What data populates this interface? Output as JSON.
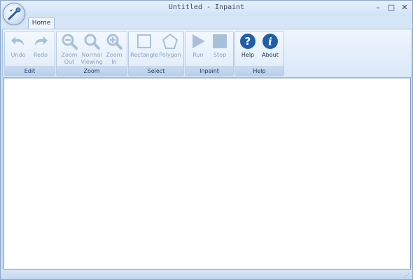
{
  "window": {
    "title": "Untitled - Inpaint"
  },
  "window_controls": {
    "minimize": "–",
    "maximize": "□",
    "close": "✕"
  },
  "tabs": [
    {
      "label": "Home"
    }
  ],
  "groups": {
    "edit": {
      "label": "Edit",
      "buttons": {
        "undo": "Undo",
        "redo": "Redo"
      }
    },
    "zoom": {
      "label": "Zoom",
      "buttons": {
        "zoom_out_1": "Zoom",
        "zoom_out_2": "Out",
        "normal_1": "Normal",
        "normal_2": "Viewing",
        "zoom_in_1": "Zoom",
        "zoom_in_2": "In"
      }
    },
    "select": {
      "label": "Select",
      "buttons": {
        "rectangle": "Rectangle",
        "polygon": "Polygon"
      }
    },
    "inpaint": {
      "label": "Inpaint",
      "buttons": {
        "run": "Run",
        "stop": "Stop"
      }
    },
    "help": {
      "label": "Help",
      "buttons": {
        "help": "Help",
        "about": "About"
      }
    }
  },
  "colors": {
    "disabled_icon": "#a9c0da",
    "help_icon": "#1f5fa8",
    "window_frame": "#c9ddf2"
  },
  "icons": [
    "app-orb-icon",
    "undo-icon",
    "redo-icon",
    "zoom-out-icon",
    "zoom-normal-icon",
    "zoom-in-icon",
    "rectangle-icon",
    "polygon-icon",
    "run-icon",
    "stop-icon",
    "help-icon",
    "about-icon"
  ]
}
